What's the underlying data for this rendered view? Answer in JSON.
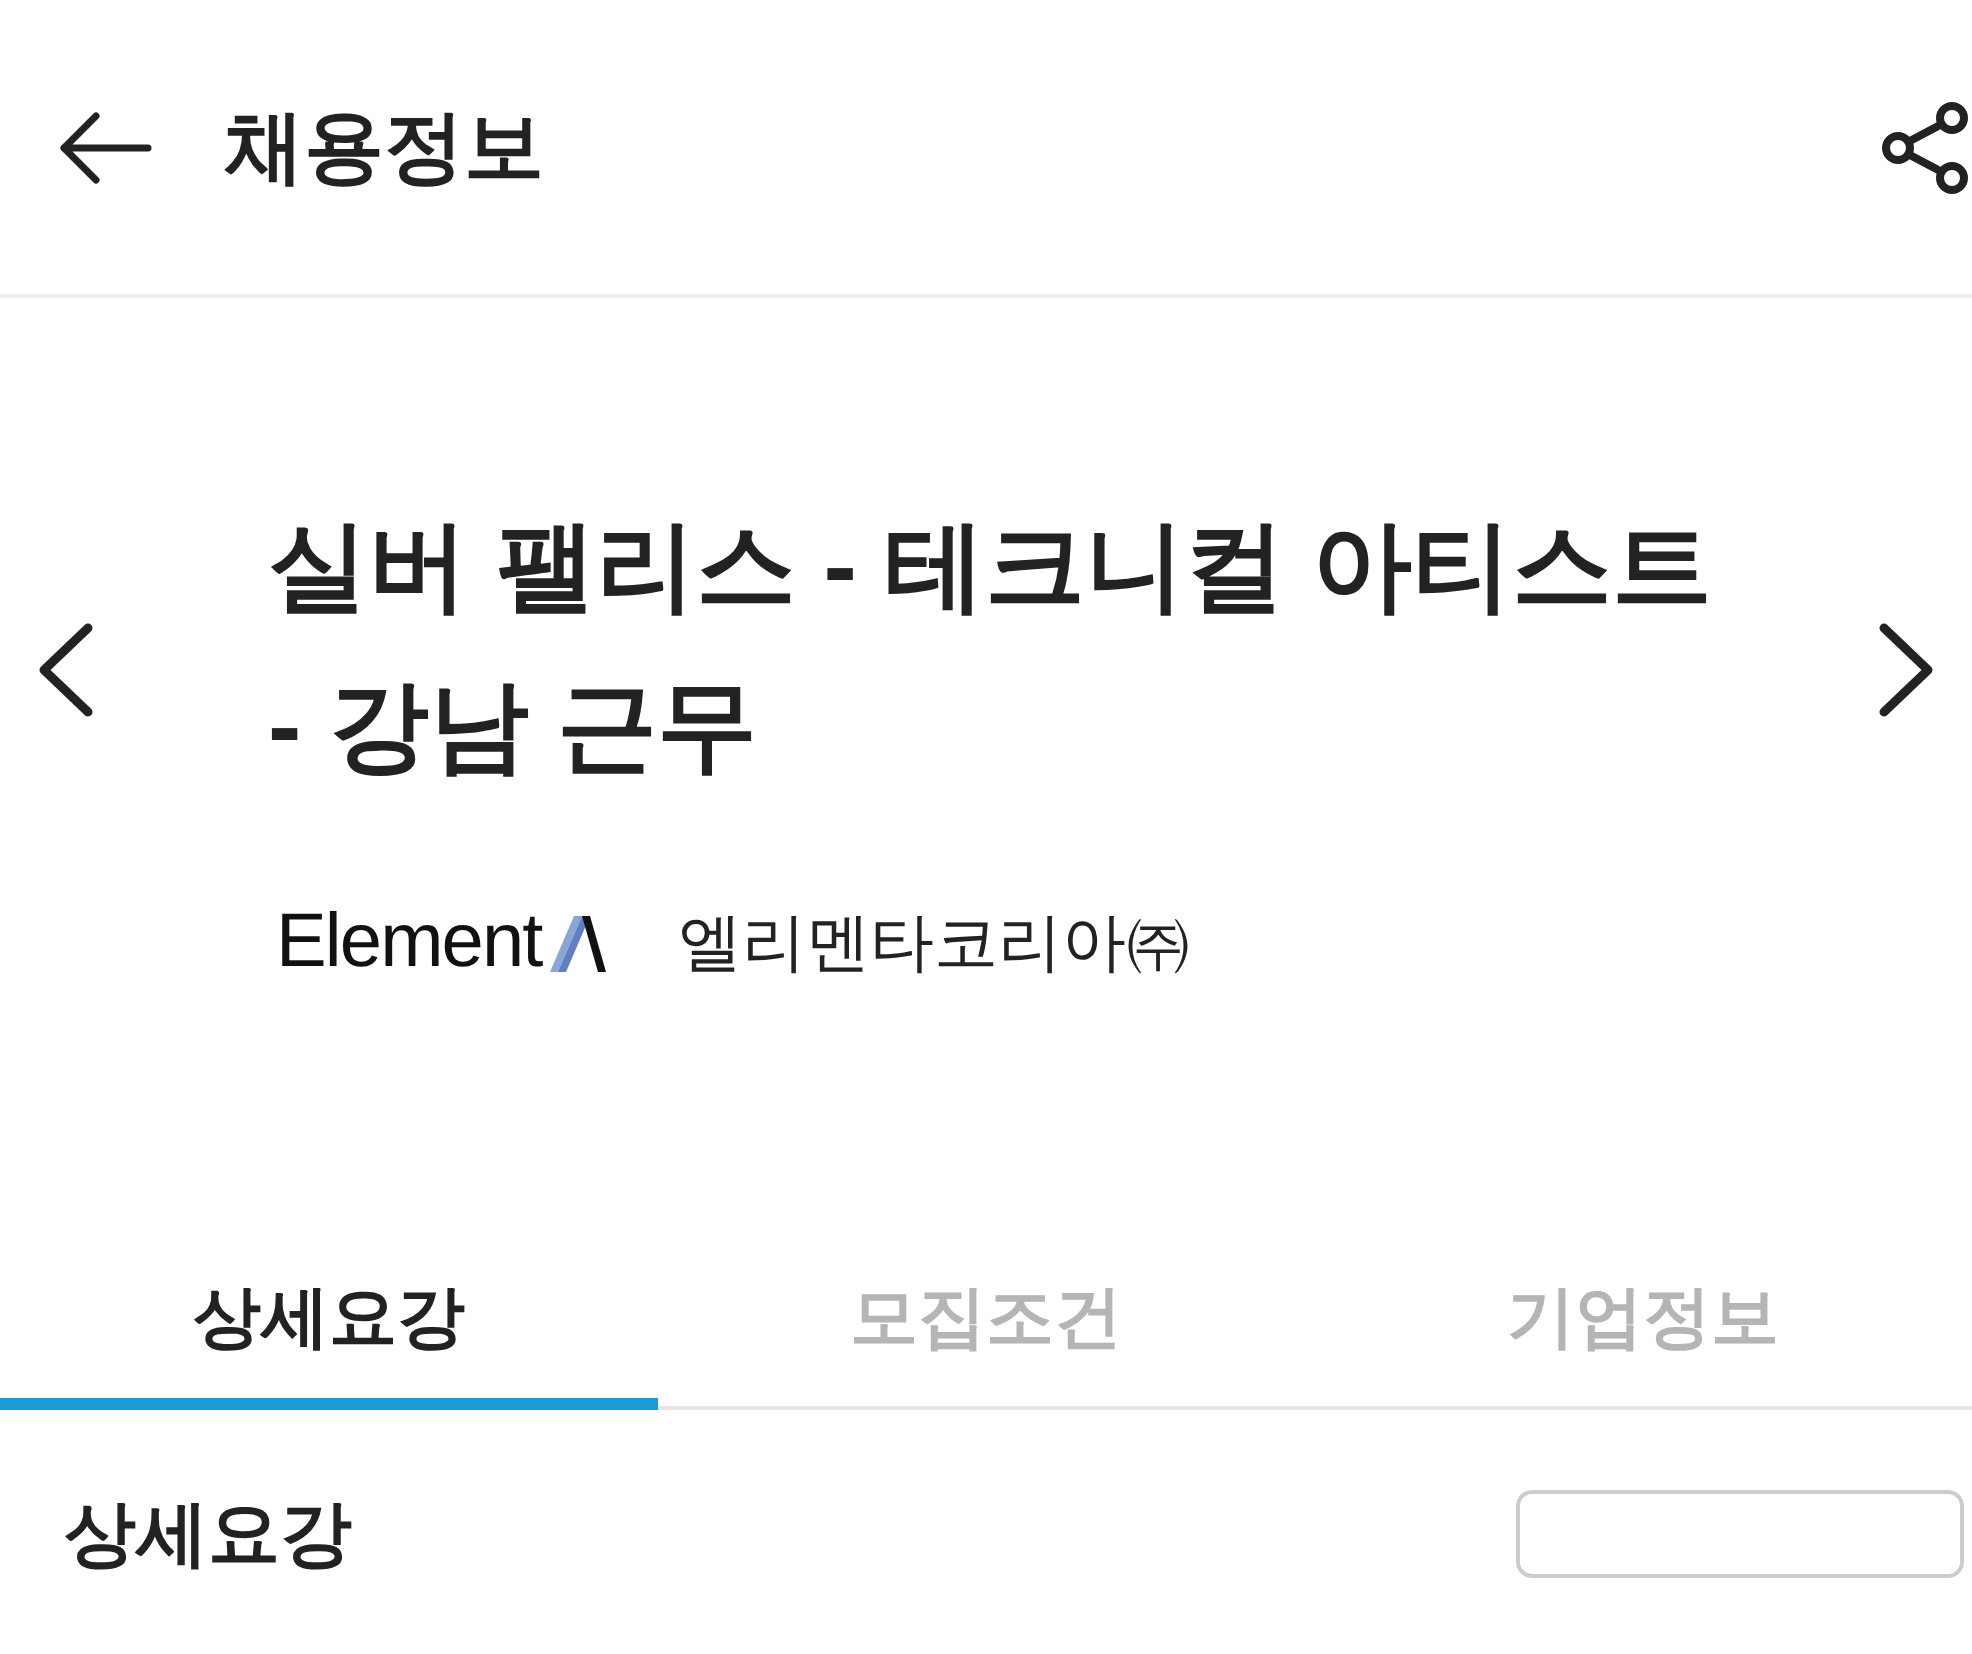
{
  "header": {
    "title": "채용정보"
  },
  "job": {
    "title": "실버 팰리스 - 테크니컬 아티스트 - 강남 근무",
    "logo_text": "Element",
    "company": "엘리멘타코리아㈜"
  },
  "tabs": [
    {
      "label": "상세요강",
      "selected": true
    },
    {
      "label": "모집조건",
      "selected": false
    },
    {
      "label": "기업정보",
      "selected": false
    }
  ],
  "section": {
    "title": "상세요강"
  }
}
